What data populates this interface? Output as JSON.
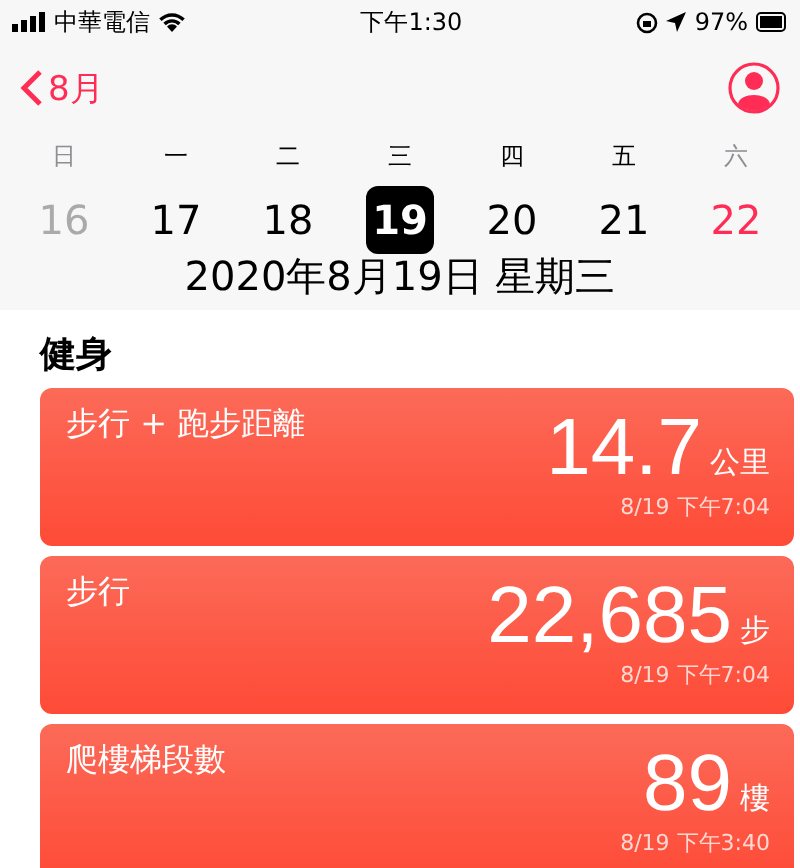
{
  "status_bar": {
    "carrier": "中華電信",
    "time": "下午1:30",
    "battery": "97%"
  },
  "nav": {
    "back": "8月"
  },
  "week": [
    {
      "weekday": "日",
      "date": "16",
      "selected": false,
      "kind": "weekend-past"
    },
    {
      "weekday": "一",
      "date": "17",
      "selected": false,
      "kind": "weekday"
    },
    {
      "weekday": "二",
      "date": "18",
      "selected": false,
      "kind": "weekday"
    },
    {
      "weekday": "三",
      "date": "19",
      "selected": true,
      "kind": "weekday"
    },
    {
      "weekday": "四",
      "date": "20",
      "selected": false,
      "kind": "weekday"
    },
    {
      "weekday": "五",
      "date": "21",
      "selected": false,
      "kind": "weekday"
    },
    {
      "weekday": "六",
      "date": "22",
      "selected": false,
      "kind": "weekend"
    }
  ],
  "date_title": "2020年8月19日 星期三",
  "section": "健身",
  "cards": [
    {
      "title": "步行 + 跑步距離",
      "value": "14.7",
      "unit": "公里",
      "time": "8/19 下午7:04"
    },
    {
      "title": "步行",
      "value": "22,685",
      "unit": "步",
      "time": "8/19 下午7:04"
    },
    {
      "title": "爬樓梯段數",
      "value": "89",
      "unit": "樓",
      "time": "8/19 下午3:40"
    }
  ]
}
